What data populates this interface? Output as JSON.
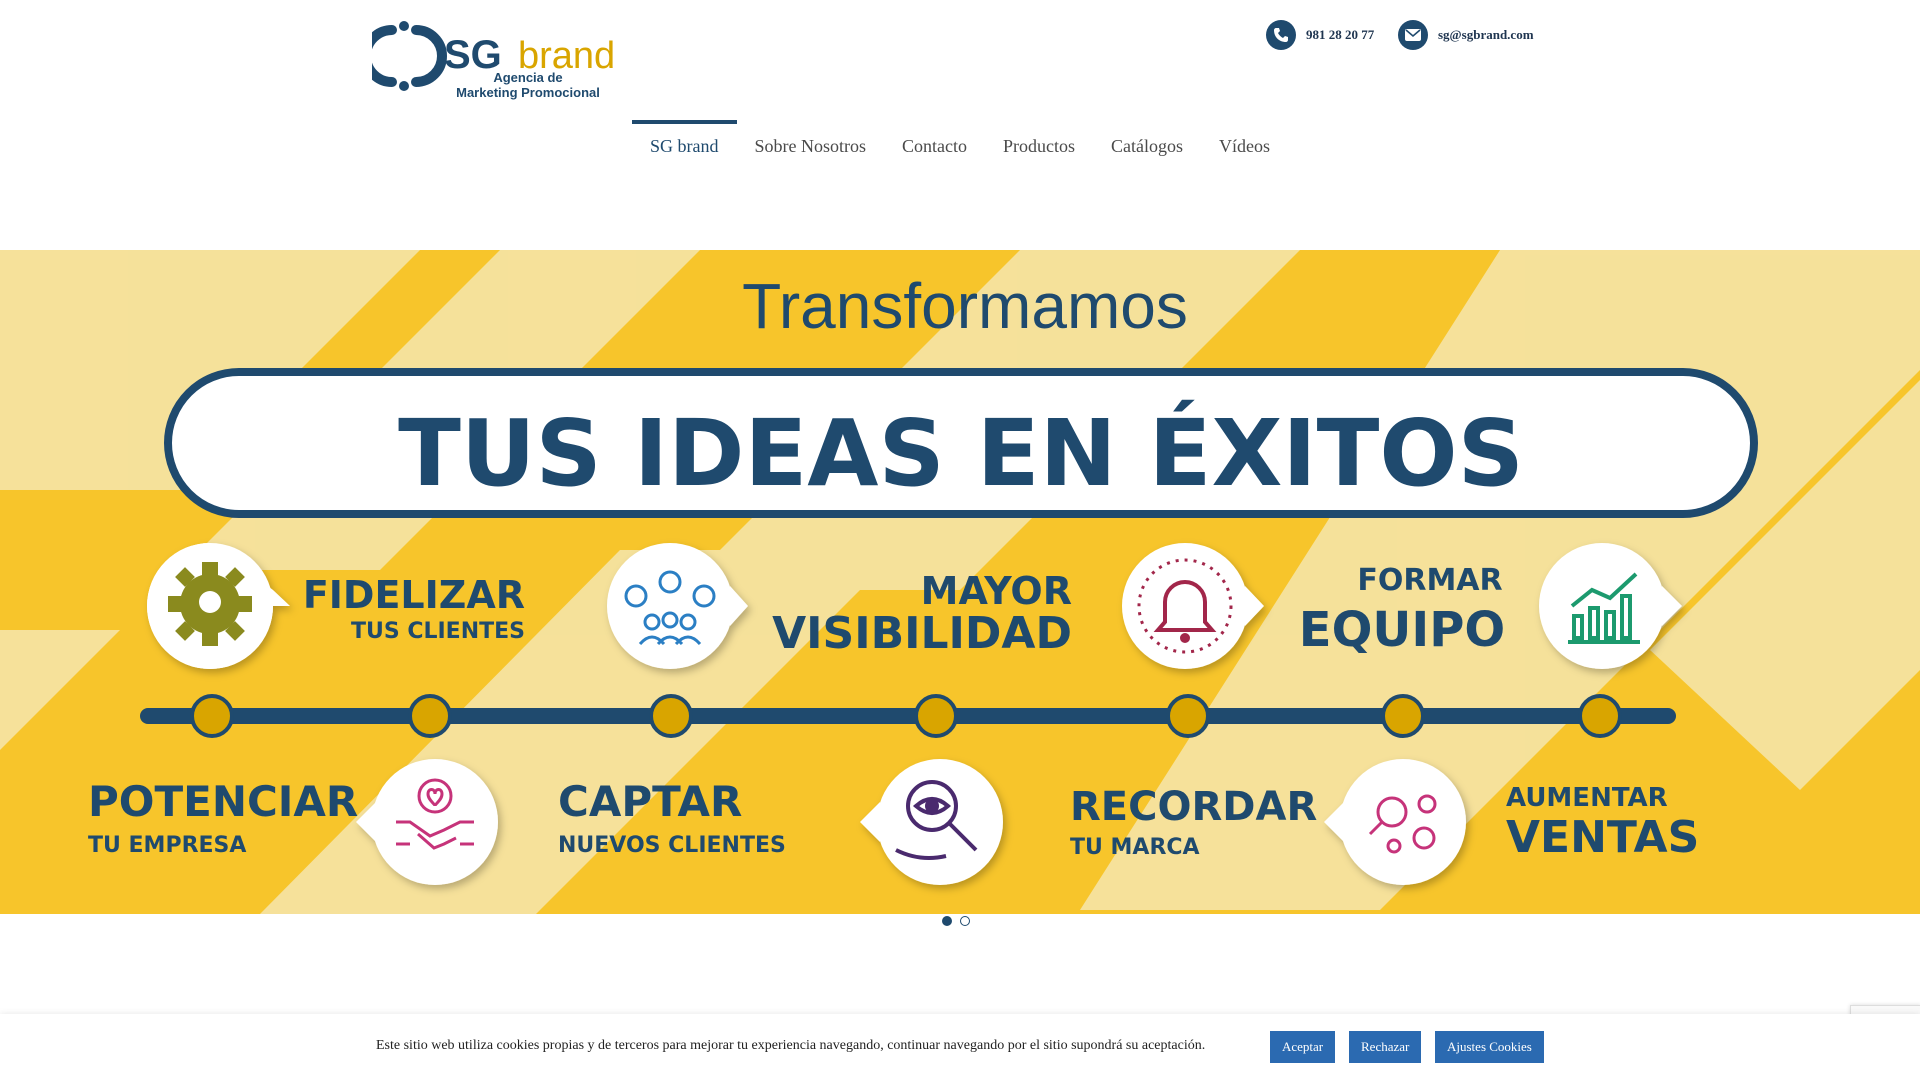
{
  "header": {
    "logo": {
      "brand_sg": "SG",
      "brand_word": "brand",
      "tagline_line1": "Agencia de",
      "tagline_line2": "Marketing Promocional"
    },
    "phone": "981 28 20 77",
    "email": "sg@sgbrand.com"
  },
  "nav": {
    "items": [
      "SG brand",
      "Sobre Nosotros",
      "Contacto",
      "Productos",
      "Catálogos",
      "Vídeos"
    ],
    "active_index": 0
  },
  "banner": {
    "headline": "Transformamos",
    "main_title": "TUS IDEAS EN ÉXITOS",
    "top_items": [
      {
        "line1": "FIDELIZAR",
        "line2": "TUS CLIENTES",
        "icon": "gear-head-icon"
      },
      {
        "line1": "MAYOR",
        "line2": "VISIBILIDAD",
        "icon": "team-network-icon"
      },
      {
        "line1": "FORMAR",
        "line2": "EQUIPO",
        "icon": "bell-icon"
      },
      {
        "icon": "growth-chart-icon"
      }
    ],
    "bottom_items": [
      {
        "line1": "POTENCIAR",
        "line2": "TU EMPRESA",
        "icon": "handshake-heart-icon"
      },
      {
        "line1": "CAPTAR",
        "line2": "NUEVOS CLIENTES",
        "icon": "eye-magnifier-icon"
      },
      {
        "line1": "RECORDAR",
        "line2": "TU MARCA",
        "icon": "search-gears-icon"
      },
      {
        "line1": "AUMENTAR",
        "line2": "VENTAS"
      }
    ],
    "slides": 2,
    "active_slide": 0
  },
  "cookie": {
    "text": "Este sitio web utiliza cookies propias y de terceros para mejorar tu experiencia navegando, continuar navegando por el sitio supondrá su aceptación.",
    "accept": "Aceptar",
    "reject": "Rechazar",
    "settings": "Ajustes Cookies"
  },
  "colors": {
    "navy": "#1f4a6e",
    "yellow": "#f7c52b",
    "light_yellow": "#f5e3a0",
    "gold": "#d9a500",
    "olive": "#8a8a1e",
    "cookie_button": "#2b6ab1"
  }
}
